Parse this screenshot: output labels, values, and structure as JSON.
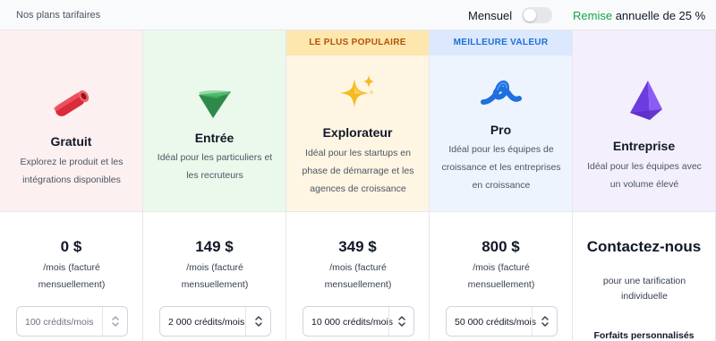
{
  "header": {
    "title": "Nos plans tarifaires",
    "billing_toggle_label": "Mensuel",
    "discount_highlight": "Remise",
    "discount_rest": "annuelle de 25 %"
  },
  "plans": [
    {
      "name": "Gratuit",
      "description": "Explorez le produit et les intégrations disponibles",
      "price": "0 $",
      "period": "/mois (facturé mensuellement)",
      "credits": "100 crédits/mois"
    },
    {
      "name": "Entrée",
      "description": "Idéal pour les particuliers et les recruteurs",
      "price": "149 $",
      "period": "/mois (facturé mensuellement)",
      "credits": "2 000 crédits/mois"
    },
    {
      "badge": "LE PLUS POPULAIRE",
      "name": "Explorateur",
      "description": "Idéal pour les startups en phase de démarrage et les agences de croissance",
      "price": "349 $",
      "period": "/mois (facturé mensuellement)",
      "credits": "10 000 crédits/mois"
    },
    {
      "badge": "MEILLEURE VALEUR",
      "name": "Pro",
      "description": "Idéal pour les équipes de croissance et les entreprises en croissance",
      "price": "800 $",
      "period": "/mois (facturé mensuellement)",
      "credits": "50 000 crédits/mois"
    },
    {
      "name": "Entreprise",
      "description": "Idéal pour les équipes avec un volume élevé",
      "contact": "Contactez-nous",
      "contact_sub": "pour une tarification individuelle",
      "custom": "Forfaits personnalisés"
    }
  ],
  "colors": {
    "gratuit_bg": "#fdf0f0",
    "entree_bg": "#ebf9ec",
    "explorateur_bg": "#fef5e3",
    "explorateur_badge_bg": "#fde7ae",
    "explorateur_badge_text": "#b45309",
    "pro_bg": "#eef4fe",
    "pro_badge_bg": "#dbe8fd",
    "pro_badge_text": "#1d6fd8",
    "entreprise_bg": "#f4effd",
    "discount_green": "#16a34a"
  },
  "icons": [
    "red-tube-icon",
    "green-cone-icon",
    "sparkles-icon",
    "blue-loop-icon",
    "purple-pyramid-icon",
    "chevron-up-down-icon"
  ]
}
